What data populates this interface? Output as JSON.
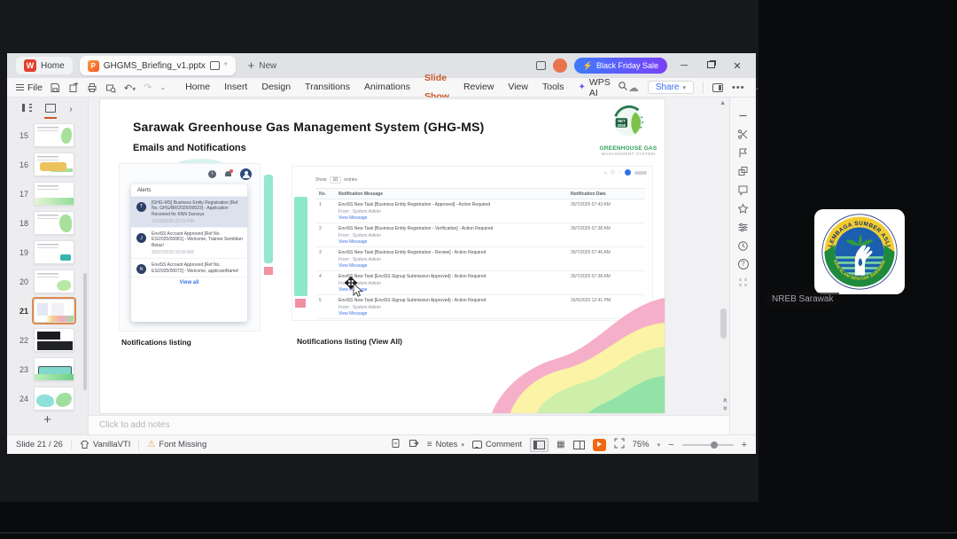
{
  "chrome": {
    "tabs": {
      "home": "Home",
      "doc": "GHGMS_Briefing_v1.pptx",
      "modified": "*",
      "new": "New",
      "sale": "Black Friday Sale"
    },
    "qat": {
      "file": "File"
    },
    "menus": [
      "Home",
      "Insert",
      "Design",
      "Transitions",
      "Animations",
      "Slide Show",
      "Review",
      "View",
      "Tools"
    ],
    "wps_ai": "WPS AI",
    "share": "Share"
  },
  "sidebar": {
    "slides": [
      "15",
      "16",
      "17",
      "18",
      "19",
      "20",
      "21",
      "22",
      "23",
      "24"
    ],
    "selected": "21"
  },
  "slide": {
    "title": "Sarawak Greenhouse Gas Management System (GHG-MS)",
    "subtitle": "Emails and Notifications",
    "logo": {
      "badge_line1": "NET",
      "badge_line2": "2050",
      "name": "GREENHOUSE GAS",
      "tagline": "MANAGEMENT SYSTEM"
    },
    "alerts": {
      "title": "Alerts",
      "items": [
        {
          "initial": "T",
          "text": "[GHG-MS] Business Entity Registration [Ref No. GHG/BR/2025/00023] - Application Received for KNN Surveys",
          "time": "21/10/2025 02:19 PM"
        },
        {
          "initial": "J",
          "text": "EnviSS Account Approved [Ref No. ES/2025/00081] - Welcome, Trainee Sembilan Belas!",
          "time": "30/07/2025 09:09 AM"
        },
        {
          "initial": "N",
          "text": "EnviSS Account Approved [Ref No. ES/2025/00072] - Welcome, applicantName!",
          "time": ""
        }
      ],
      "view_all": "View all"
    },
    "notif_table": {
      "show": "Show",
      "page_size": "10",
      "entries": "entries",
      "headers": {
        "no": "No.",
        "message": "Notification Message",
        "date": "Notification Date"
      },
      "rows": [
        {
          "no": "1",
          "message": "EnviSS New Task [Business Entity Registration - Approved] - Action Required",
          "from": "From : System Admin",
          "link": "View Message",
          "date": "30/7/2025 07:43 AM"
        },
        {
          "no": "2",
          "message": "EnviSS New Task [Business Entity Registration - Verification] - Action Required",
          "from": "From : System Admin",
          "link": "View Message",
          "date": "30/7/2025 07:38 AM"
        },
        {
          "no": "3",
          "message": "EnviSS New Task [Business Entity Registration - Review] - Action Required",
          "from": "From : System Admin",
          "link": "View Message",
          "date": "30/7/2025 07:46 AM"
        },
        {
          "no": "4",
          "message": "EnviSS New Task [EnviSS Signup Submission Approved] - Action Required",
          "from": "From : System Admin",
          "link": "View Message",
          "date": "30/7/2025 07:38 AM"
        },
        {
          "no": "5",
          "message": "EnviSS New Task [EnviSS Signup Submission Approved] - Action Required",
          "from": "From : System Admin",
          "link": "View Message",
          "date": "16/6/2025 12:41 PM"
        }
      ]
    },
    "captions": {
      "left": "Notifications listing",
      "right": "Notifications listing (View All)"
    }
  },
  "notes": {
    "placeholder": "Click to add notes"
  },
  "statusbar": {
    "slide_counter": "Slide 21 / 26",
    "theme": "VanillaVTI",
    "font_warning": "Font Missing",
    "notes": "Notes",
    "comment": "Comment",
    "zoom": "75%"
  },
  "call": {
    "participant": "NREB Sarawak",
    "logo_top": "LEMBAGA SUMBER ASLI",
    "logo_bottom": "DAN ALAM SEKITAR SARAWAK"
  }
}
